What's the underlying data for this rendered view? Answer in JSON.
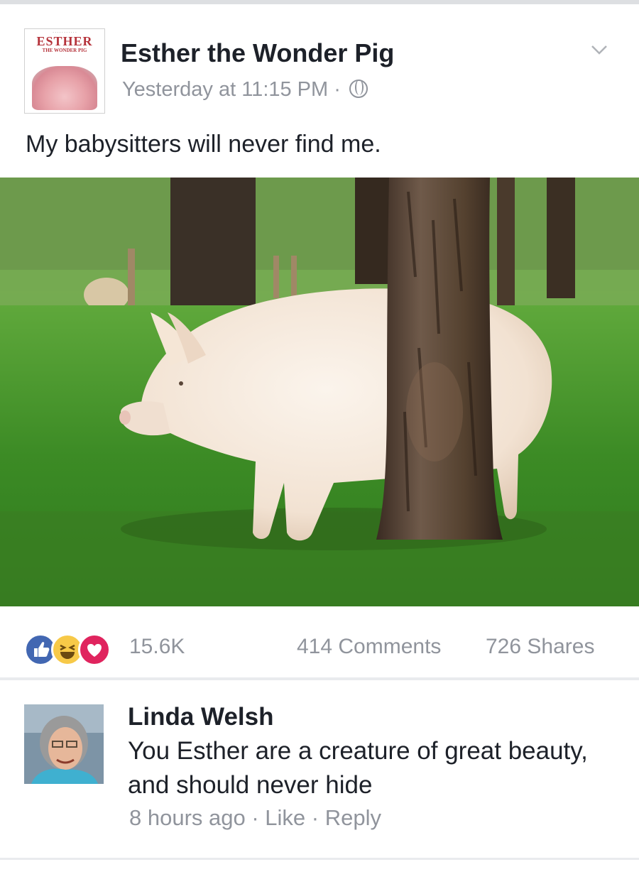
{
  "post": {
    "page_name": "Esther the Wonder Pig",
    "timestamp": "Yesterday at 11:15 PM",
    "separator": " · ",
    "privacy_icon": "globe-icon",
    "text": "My babysitters will never find me.",
    "avatar_logo": {
      "word": "ESTHER",
      "sub": "THE WONDER PIG"
    },
    "photo_subject": "pig-behind-tree"
  },
  "reactions": {
    "icons": [
      "like-icon",
      "haha-icon",
      "love-icon"
    ],
    "count": "15.6K",
    "comments": "414 Comments",
    "shares": "726 Shares"
  },
  "comment": {
    "author": "Linda Welsh",
    "text": "You Esther are a creature of great beauty, and should never hide",
    "time": "8 hours ago",
    "sep": " · ",
    "like": "Like",
    "reply": "Reply"
  },
  "colors": {
    "name": "#1d2129",
    "meta": "#90949c",
    "like_blue": "#4267b2",
    "love_red": "#e0245e",
    "haha_yellow": "#f7c948"
  }
}
